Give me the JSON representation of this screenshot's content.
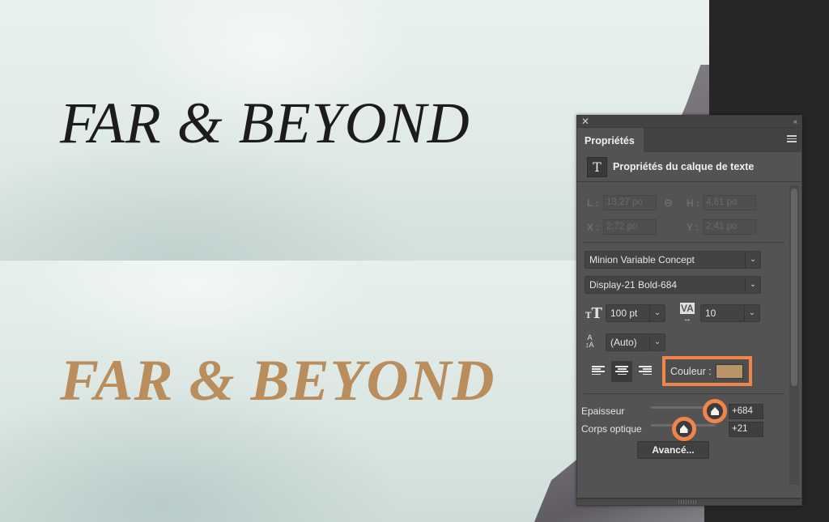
{
  "canvas": {
    "top_text": "FAR & BEYOND",
    "bottom_text": "FAR & BEYOND",
    "top_text_color": "#1c1c1c",
    "bottom_text_color": "#b98d5c"
  },
  "panel": {
    "tab_label": "Propriétés",
    "header_title": "Propriétés du calque de texte",
    "close_icon": "✕",
    "collapse_icon": "‹‹",
    "geometry": {
      "width_label": "L :",
      "width_value": "13,27 po",
      "height_label": "H :",
      "height_value": "4,61 po",
      "x_label": "X :",
      "x_value": "2,72 po",
      "y_label": "Y :",
      "y_value": "2,41 po"
    },
    "font_family": "Minion Variable Concept",
    "font_style": "Display-21 Bold-684",
    "font_size": "100 pt",
    "tracking": "10",
    "leading": "(Auto)",
    "color_label": "Couleur :",
    "color_value": "#b99468",
    "highlight_color": "#f0844a",
    "sliders": [
      {
        "label": "Epaisseur",
        "value": "+684",
        "fraction": 0.88
      },
      {
        "label": "Corps optique",
        "value": "+21",
        "fraction": 0.45
      }
    ],
    "advanced_button": "Avancé...",
    "icons": {
      "dropdown_arrow": "⌄",
      "link": "⊖"
    }
  }
}
